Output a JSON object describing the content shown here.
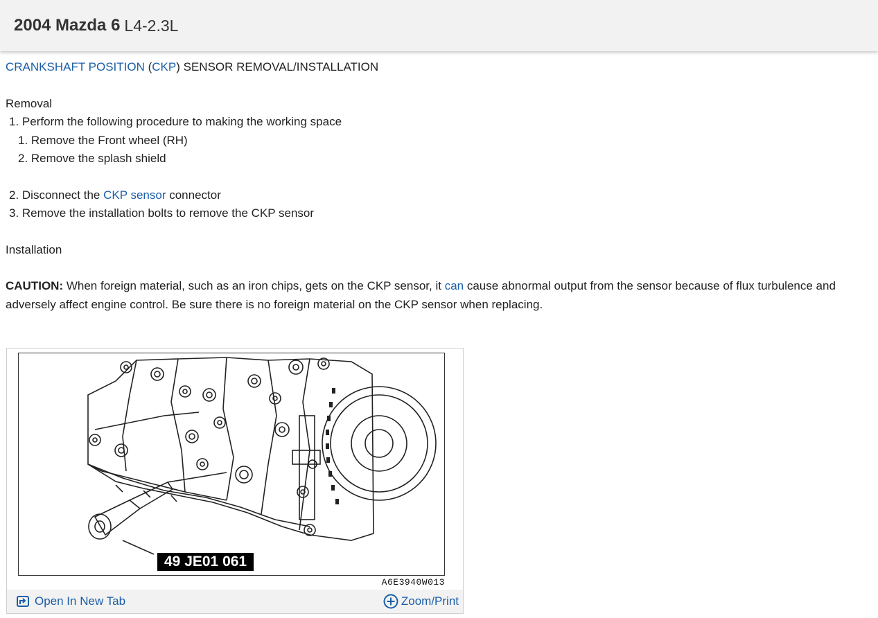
{
  "header": {
    "vehicle": "2004 Mazda 6",
    "engine": "L4-2.3L"
  },
  "doc": {
    "title_link1": "CRANKSHAFT POSITION",
    "title_paren_open": " (",
    "title_link2": "CKP",
    "title_rest": ") SENSOR REMOVAL/INSTALLATION",
    "removal_heading": "Removal",
    "step1": "1. Perform the following procedure to making the working space",
    "step1_sub1": "1. Remove the Front wheel (RH)",
    "step1_sub2": "2. Remove the splash shield",
    "step2_pre": "2. Disconnect the ",
    "step2_link": "CKP sensor",
    "step2_post": " connector",
    "step3": "3. Remove the installation bolts to remove the CKP sensor",
    "installation_heading": "Installation",
    "caution_label": "CAUTION:",
    "caution_pre": " When foreign material, such as an iron chips, gets on the CKP sensor, it ",
    "caution_link": "can",
    "caution_post": " cause abnormal output from the sensor because of flux turbulence and adversely affect engine control. Be sure there is no foreign material on the CKP sensor when replacing."
  },
  "figure": {
    "callout_label": "49 JE01 061",
    "figure_code": "A6E3940W013",
    "open_tab_label": "Open In New Tab",
    "zoom_label": "Zoom/Print",
    "open_tab_icon": "open-external-icon",
    "zoom_icon": "plus-circle-icon",
    "link_color": "#1a5ea8"
  }
}
